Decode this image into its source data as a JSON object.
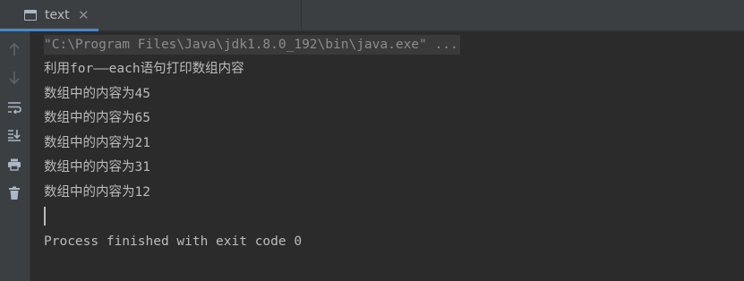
{
  "tab": {
    "label": "text",
    "close": "✕"
  },
  "toolbar": {
    "icons": [
      "up-arrow-icon",
      "down-arrow-icon",
      "soft-wrap-icon",
      "scroll-to-end-icon",
      "print-icon",
      "trash-icon"
    ],
    "color": "#5e6366"
  },
  "console": {
    "command": "\"C:\\Program Files\\Java\\jdk1.8.0_192\\bin\\java.exe\" ...",
    "lines": [
      "利用for——each语句打印数组内容",
      "数组中的内容为45",
      "数组中的内容为65",
      "数组中的内容为21",
      "数组中的内容为31",
      "数组中的内容为12"
    ],
    "exit_message": "Process finished with exit code 0"
  },
  "colors": {
    "accent": "#4a88c7",
    "background": "#2b2b2b",
    "text": "#bbbbbb",
    "command_text": "#8c8c8c"
  }
}
